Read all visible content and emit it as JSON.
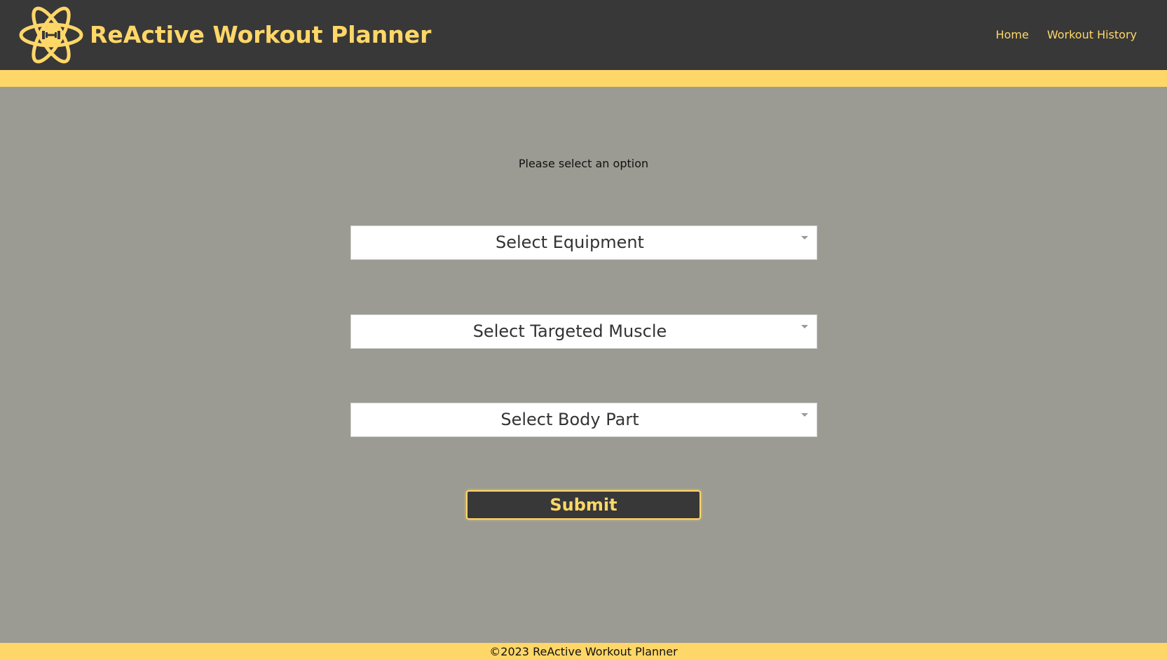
{
  "header": {
    "app_title": "ReActive Workout Planner",
    "logo_icon": "atom-dumbbell-icon",
    "nav": [
      {
        "label": "Home"
      },
      {
        "label": "Workout History"
      }
    ]
  },
  "main": {
    "prompt": "Please select an option",
    "selects": [
      {
        "selected": "Select Equipment"
      },
      {
        "selected": "Select Targeted Muscle"
      },
      {
        "selected": "Select Body Part"
      }
    ],
    "submit_label": "Submit"
  },
  "footer": {
    "text": "©2023 ReActive Workout Planner"
  },
  "colors": {
    "header_bg": "#383838",
    "accent": "#ffd768",
    "page_bg": "#9b9b93"
  }
}
